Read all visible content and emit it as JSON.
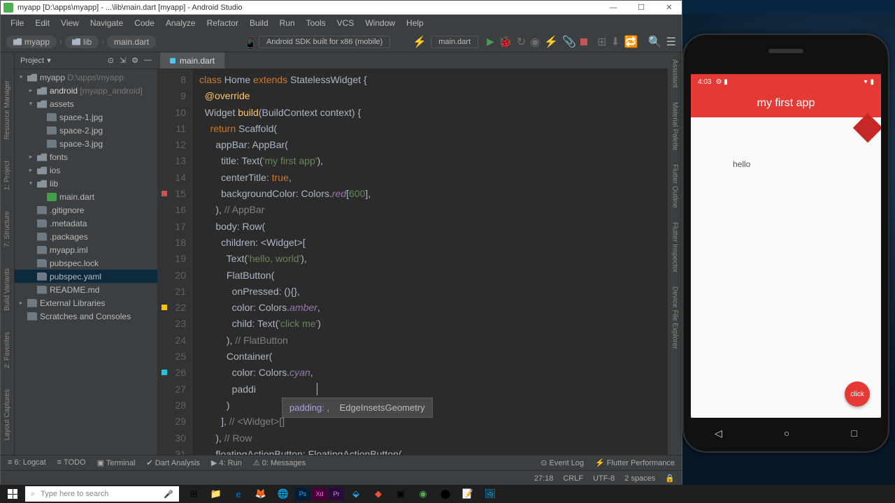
{
  "window": {
    "title": "myapp [D:\\apps\\myapp] - ...\\lib\\main.dart [myapp] - Android Studio",
    "minimize": "—",
    "maximize": "☐",
    "close": "✕"
  },
  "menu": [
    "File",
    "Edit",
    "View",
    "Navigate",
    "Code",
    "Analyze",
    "Refactor",
    "Build",
    "Run",
    "Tools",
    "VCS",
    "Window",
    "Help"
  ],
  "breadcrumb": {
    "root": "myapp",
    "mid": "lib",
    "leaf": "main.dart"
  },
  "device_select": "Android SDK built for x86 (mobile)",
  "run_config": "main.dart",
  "left_tabs": [
    "Resource Manager",
    "1: Project",
    "7: Structure",
    "Build Variants",
    "2: Favorites",
    "Layout Captures"
  ],
  "right_tabs": [
    "Assistant",
    "Material Palette",
    "Flutter Outline",
    "Flutter Inspector",
    "Device File Explorer"
  ],
  "panel": {
    "title": "Project",
    "dropdown": "▾"
  },
  "tree": [
    {
      "depth": 0,
      "arrow": "▾",
      "icon": "folder",
      "label": "myapp",
      "suffix": " D:\\apps\\myapp"
    },
    {
      "depth": 1,
      "arrow": "▸",
      "icon": "folder",
      "label": "android",
      "suffix": " [myapp_android]",
      "bold": true
    },
    {
      "depth": 1,
      "arrow": "▾",
      "icon": "folder",
      "label": "assets",
      "suffix": ""
    },
    {
      "depth": 2,
      "arrow": "",
      "icon": "file",
      "label": "space-1.jpg",
      "suffix": ""
    },
    {
      "depth": 2,
      "arrow": "",
      "icon": "file",
      "label": "space-2.jpg",
      "suffix": ""
    },
    {
      "depth": 2,
      "arrow": "",
      "icon": "file",
      "label": "space-3.jpg",
      "suffix": ""
    },
    {
      "depth": 1,
      "arrow": "▸",
      "icon": "folder",
      "label": "fonts",
      "suffix": ""
    },
    {
      "depth": 1,
      "arrow": "▸",
      "icon": "folder",
      "label": "ios",
      "suffix": ""
    },
    {
      "depth": 1,
      "arrow": "▾",
      "icon": "folder",
      "label": "lib",
      "suffix": ""
    },
    {
      "depth": 2,
      "arrow": "",
      "icon": "dart",
      "label": "main.dart",
      "suffix": ""
    },
    {
      "depth": 1,
      "arrow": "",
      "icon": "file",
      "label": ".gitignore",
      "suffix": ""
    },
    {
      "depth": 1,
      "arrow": "",
      "icon": "file",
      "label": ".metadata",
      "suffix": ""
    },
    {
      "depth": 1,
      "arrow": "",
      "icon": "file",
      "label": ".packages",
      "suffix": ""
    },
    {
      "depth": 1,
      "arrow": "",
      "icon": "file",
      "label": "myapp.iml",
      "suffix": ""
    },
    {
      "depth": 1,
      "arrow": "",
      "icon": "file",
      "label": "pubspec.lock",
      "suffix": ""
    },
    {
      "depth": 1,
      "arrow": "",
      "icon": "file",
      "label": "pubspec.yaml",
      "suffix": "",
      "sel": true
    },
    {
      "depth": 1,
      "arrow": "",
      "icon": "file",
      "label": "README.md",
      "suffix": ""
    },
    {
      "depth": 0,
      "arrow": "▸",
      "icon": "lib",
      "label": "External Libraries",
      "suffix": ""
    },
    {
      "depth": 0,
      "arrow": "",
      "icon": "scratch",
      "label": "Scratches and Consoles",
      "suffix": ""
    }
  ],
  "tab": {
    "name": "main.dart"
  },
  "gutter": {
    "start": 8,
    "end": 31
  },
  "code_lines": [
    "<span class='kw'>class</span> <span class='ty'>Home</span> <span class='kw'>extends</span> <span class='ty'>StatelessWidget</span> {",
    "  <span class='id'>@override</span>",
    "  <span class='ty'>Widget</span> <span class='id'>build</span>(<span class='ty'>BuildContext</span> context) {",
    "    <span class='kw'>return</span> <span class='ty'>Scaffold</span>(",
    "      appBar: <span class='ty'>AppBar</span>(",
    "        title: <span class='ty'>Text</span>(<span class='str'>'my first app'</span>),",
    "        centerTitle: <span class='kw'>true</span>,",
    "        backgroundColor: <span class='ty'>Colors</span>.<span class='it'>red</span>[<span class='str'>600</span>],",
    "      ), <span class='cmt'>// AppBar</span>",
    "      body: <span class='ty'>Row</span>(",
    "        children: &lt;<span class='ty'>Widget</span>&gt;[",
    "          <span class='ty'>Text</span>(<span class='str'>'hello, world'</span>),",
    "          <span class='ty'>FlatButton</span>(",
    "            onPressed: (){},",
    "            color: <span class='ty'>Colors</span>.<span class='it'>amber</span>,",
    "            child: <span class='ty'>Text</span>(<span class='str'>'click me'</span>)",
    "          ), <span class='cmt'>// FlatButton</span>",
    "          <span class='ty'>Container</span>(",
    "            color: <span class='ty'>Colors</span>.<span class='it'>cyan</span>,",
    "            paddi",
    "          )",
    "        ], <span class='cmt'>// &lt;Widget&gt;[]</span>",
    "      ), <span class='cmt'>// Row</span>",
    "      floatingActionButton: <span class='ty'>FloatingActionButton</span>("
  ],
  "autocomplete": {
    "left": "padding: ,",
    "right": "EdgeInsetsGeometry"
  },
  "gutter_marks": [
    {
      "line": 15,
      "color": "#c75450",
      "shape": "sq"
    },
    {
      "line": 22,
      "color": "#ffc107",
      "shape": "sq"
    },
    {
      "line": 26,
      "color": "#26c6da",
      "shape": "sq"
    }
  ],
  "bottom_tabs": [
    "≡ 6: Logcat",
    "≡ TODO",
    "▣ Terminal",
    "✔ Dart Analysis",
    "▶ 4: Run",
    "⚠ 0: Messages"
  ],
  "bottom_right": [
    "⊙ Event Log",
    "⚡ Flutter Performance"
  ],
  "status": {
    "pos": "27:18",
    "lineend": "CRLF",
    "enc": "UTF-8",
    "indent": "2 spaces"
  },
  "emulator": {
    "time": "4:03",
    "appbar_title": "my first app",
    "body_text": "hello",
    "fab": "click"
  },
  "taskbar": {
    "search_placeholder": "Type here to search"
  }
}
